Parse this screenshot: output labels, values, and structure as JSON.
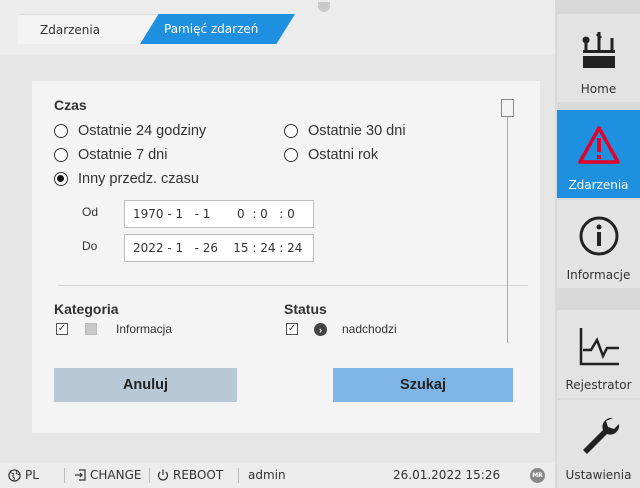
{
  "tabs": [
    {
      "label": "Zdarzenia",
      "active": false
    },
    {
      "label": "Pamięć zdarzeń",
      "active": true
    }
  ],
  "time_section": {
    "title": "Czas",
    "options": [
      {
        "label": "Ostatnie 24 godziny",
        "checked": false
      },
      {
        "label": "Ostatnie 30 dni",
        "checked": false
      },
      {
        "label": "Ostatnie 7 dni",
        "checked": false
      },
      {
        "label": "Ostatni rok",
        "checked": false
      },
      {
        "label": "Inny przedz. czasu",
        "checked": true
      }
    ],
    "from_label": "Od",
    "from_value": "1970 - 1   - 1       0  : 0   : 0",
    "to_label": "Do",
    "to_value": "2022 - 1   - 26    15 : 24 : 24"
  },
  "category_section": {
    "title": "Kategoria",
    "item_label": "Informacja"
  },
  "status_section": {
    "title": "Status",
    "item_label": "nadchodzi"
  },
  "buttons": {
    "cancel": "Anuluj",
    "search": "Szukaj"
  },
  "statusbar": {
    "language": "PL",
    "change": "CHANGE",
    "reboot": "REBOOT",
    "user": "admin",
    "datetime": "26.01.2022 15:26",
    "badge": "MR"
  },
  "sidebar": [
    {
      "label": "Home",
      "icon": "transformer-icon",
      "active": false
    },
    {
      "label": "Zdarzenia",
      "icon": "warning-icon",
      "active": true
    },
    {
      "label": "Informacje",
      "icon": "info-icon",
      "active": false
    },
    {
      "label": "Rejestrator",
      "icon": "waveform-icon",
      "active": false
    },
    {
      "label": "Ustawienia",
      "icon": "wrench-icon",
      "active": false
    }
  ],
  "colors": {
    "accent": "#1f8fe0",
    "cancel_button": "#b9c8d6",
    "search_button": "#7fb5e6"
  }
}
